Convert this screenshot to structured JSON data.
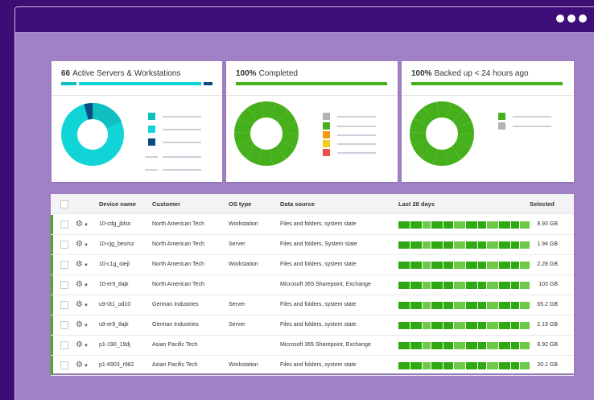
{
  "window": {
    "controls": [
      "dot",
      "dot",
      "dot"
    ]
  },
  "cards": [
    {
      "bold": "66",
      "title": "Active Servers & Workstations"
    },
    {
      "bold": "100%",
      "title": "Completed"
    },
    {
      "bold": "100%",
      "title": "Backed up < 24 hours ago"
    }
  ],
  "colors": {
    "accent": "#45b01b",
    "teal": "#0fbfbf",
    "cyan": "#11d4d6",
    "navy": "#0b4b83",
    "purple_bg": "#a181c6",
    "titlebar": "#3e0d78"
  },
  "table": {
    "headers": [
      "Device name",
      "Customer",
      "OS type",
      "Data source",
      "Last 28 days",
      "Selected"
    ],
    "rows": [
      {
        "device": "10-cdg_jblsn",
        "customer": "North American Tech",
        "os": "Workstation",
        "source": "Files and folders, system state",
        "selected": "8.93 GB"
      },
      {
        "device": "10-cjg_besmz",
        "customer": "North American Tech",
        "os": "Server",
        "source": "Files and folders, System state",
        "selected": "1.94 GB"
      },
      {
        "device": "10-c1g_oiejl",
        "customer": "North American Tech",
        "os": "Workstation",
        "source": "Files and folders, system state",
        "selected": "2.28 GB"
      },
      {
        "device": "10-er9_tlajk",
        "customer": "North American Tech",
        "os": "",
        "source": "Microsoft 365 Sharepoint, Exchange",
        "selected": "103 GB"
      },
      {
        "device": "u9-0t1_od10",
        "customer": "German Industries",
        "os": "Server",
        "source": "Files and folders, system state",
        "selected": "65.2 GB"
      },
      {
        "device": "u9-er9_tlajk",
        "customer": "German Industries",
        "os": "Server",
        "source": "Files and folders, system state",
        "selected": "2.19 GB"
      },
      {
        "device": "p1-190_19dj",
        "customer": "Asian Pacific Tech",
        "os": "",
        "source": "Microsoft 365 Sharepoint, Exchange",
        "selected": "8.92 GB"
      },
      {
        "device": "p1-6903_r982",
        "customer": "Asian Pacific Tech",
        "os": "Workstation",
        "source": "Files and folders, system state",
        "selected": "20.1 GB"
      }
    ]
  }
}
